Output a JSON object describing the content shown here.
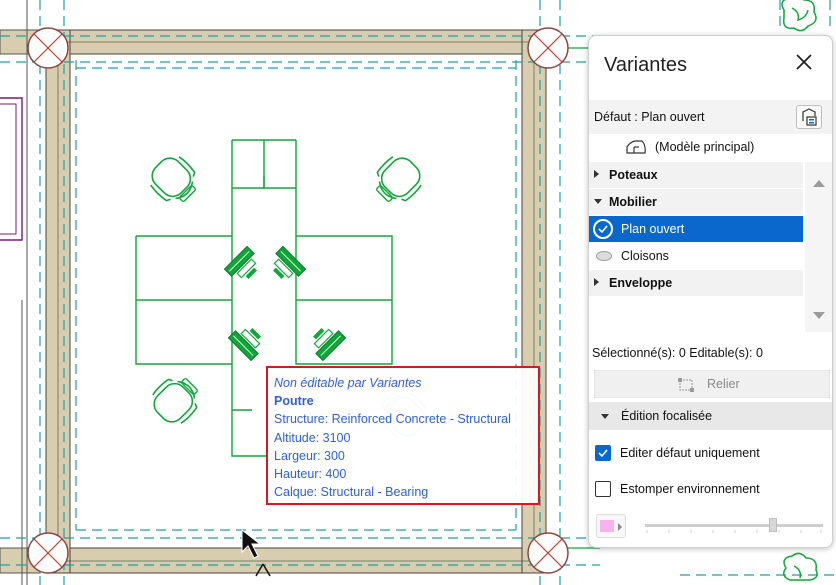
{
  "tooltip": {
    "status": "Non éditable par Variantes",
    "element_type": "Poutre",
    "structure": "Structure: Reinforced Concrete - Structural",
    "altitude": "Altitude: 3100",
    "largeur": "Largeur: 300",
    "hauteur": "Hauteur: 400",
    "calque": "Calque: Structural - Bearing"
  },
  "panel": {
    "title": "Variantes",
    "default_label": "Défaut : Plan ouvert",
    "main_model": "(Modèle principal)",
    "tree": [
      {
        "label": "Poteaux",
        "kind": "group",
        "expanded": false
      },
      {
        "label": "Mobilier",
        "kind": "group",
        "expanded": true
      },
      {
        "label": "Plan ouvert",
        "kind": "variant",
        "selected": true
      },
      {
        "label": "Cloisons",
        "kind": "variant",
        "selected": false
      },
      {
        "label": "Enveloppe",
        "kind": "group",
        "expanded": false
      }
    ],
    "status": "Sélectionné(s): 0 Editable(s): 0",
    "relier_label": "Relier",
    "focus_section": "Édition focalisée",
    "checkbox_edit_default": {
      "label": "Editer défaut uniquement",
      "checked": true
    },
    "checkbox_fade": {
      "label": "Estomper environnement",
      "checked": false
    },
    "fade_color": "#f7b3ee",
    "opacity_level": 0.72
  },
  "colors": {
    "wall_fill": "#d8ceaf",
    "furniture": "#10a63a",
    "grid_dash": "#1aa3a3",
    "column_outline": "#cc3a2a",
    "accent": "#0a68cc",
    "highlight_border": "#e0161d",
    "tooltip_text": "#3060e0"
  },
  "icons": {
    "close": "close-icon",
    "model": "house-outline-icon",
    "default_btn": "variant-settings-icon",
    "relier": "link-frame-icon",
    "cursor": "pointer-cursor-icon"
  }
}
